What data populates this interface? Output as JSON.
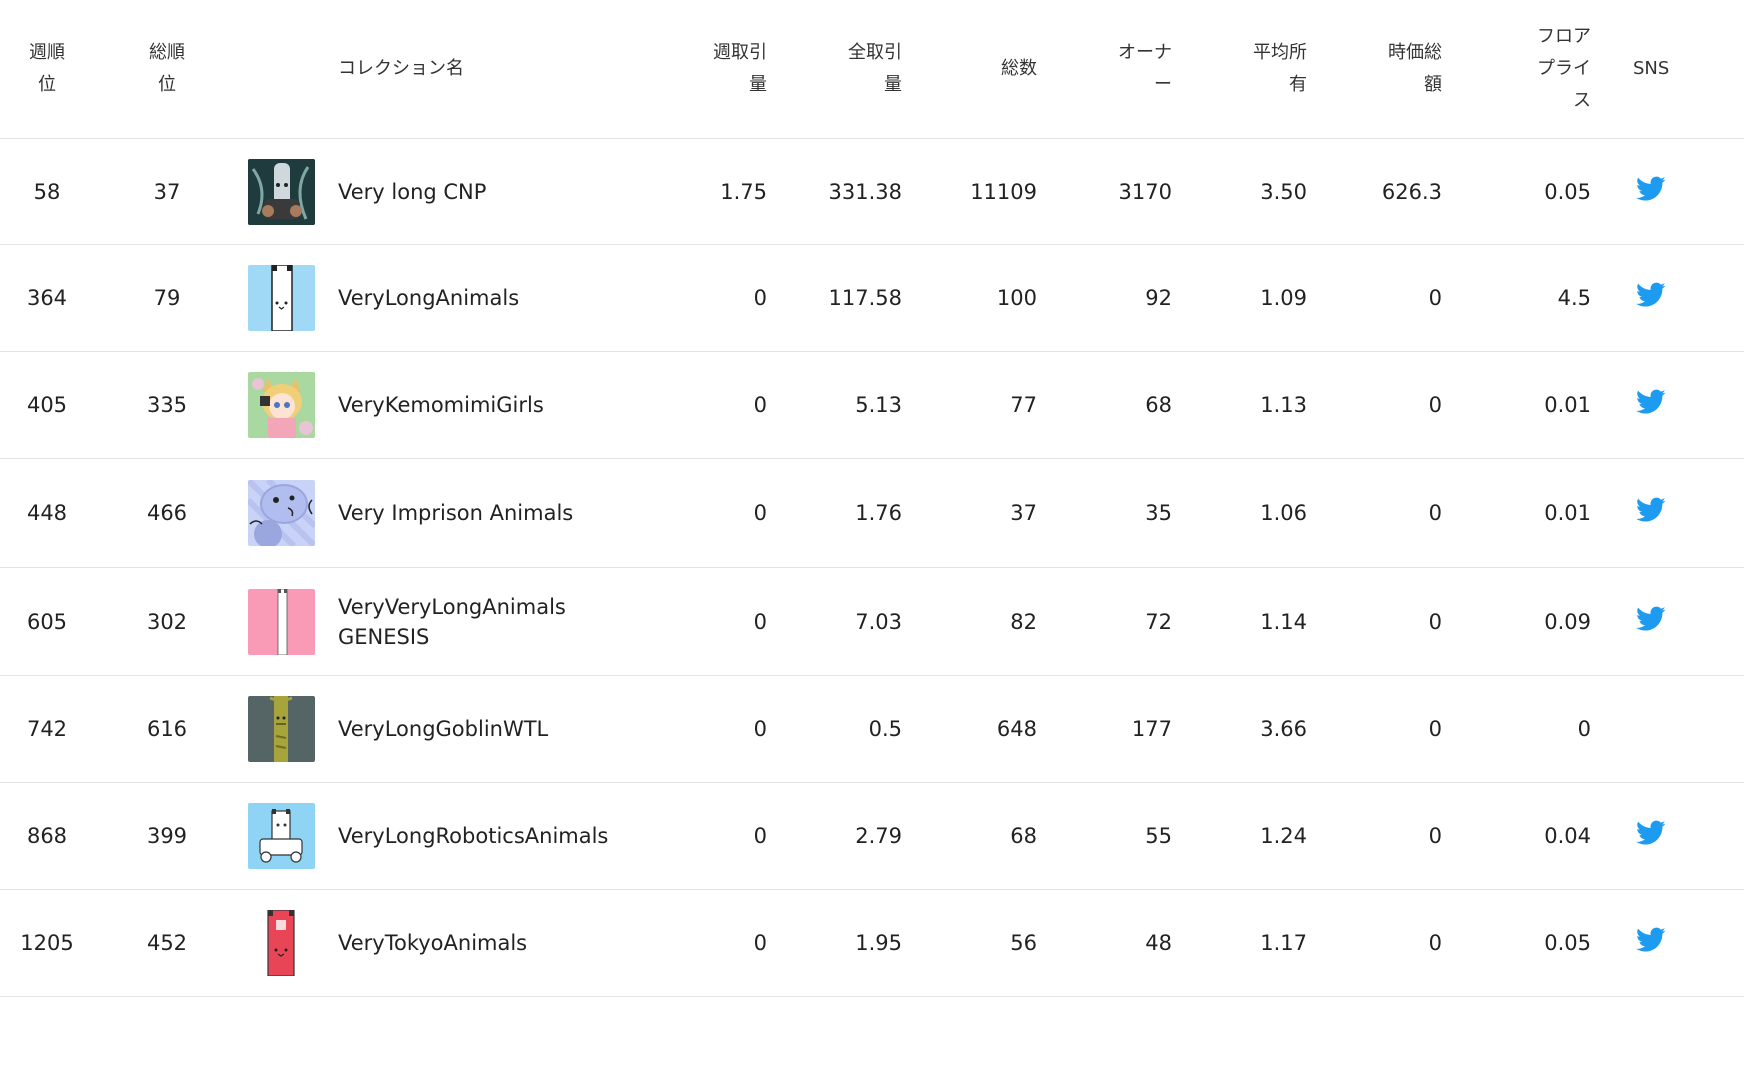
{
  "header": {
    "week_rank": "週順\n位",
    "total_rank": "総順\n位",
    "name": "コレクション名",
    "weekly_volume": "週取引\n量",
    "all_volume": "全取引\n量",
    "total_count": "総数",
    "owners": "オーナ\nー",
    "avg_holding": "平均所\n有",
    "market_cap": "時価総\n額",
    "floor_price": "フロア\nプライ\nス",
    "sns": "SNS"
  },
  "colors": {
    "twitter": "#1d9bf0",
    "divider": "#e3e3e3",
    "text": "#222222"
  },
  "rows": [
    {
      "week_rank": "58",
      "total_rank": "37",
      "thumb_icon": "cnp-character-thumbnail",
      "name": "Very long CNP",
      "weekly_volume": "1.75",
      "all_volume": "331.38",
      "total": "11109",
      "owners": "3170",
      "avg": "3.50",
      "mcap": "626.3",
      "floor": "0.05",
      "twitter": true
    },
    {
      "week_rank": "364",
      "total_rank": "79",
      "thumb_icon": "long-white-animal-thumbnail",
      "name": "VeryLongAnimals",
      "weekly_volume": "0",
      "all_volume": "117.58",
      "total": "100",
      "owners": "92",
      "avg": "1.09",
      "mcap": "0",
      "floor": "4.5",
      "twitter": true
    },
    {
      "week_rank": "405",
      "total_rank": "335",
      "thumb_icon": "kemonomimi-girl-thumbnail",
      "name": "VeryKemomimiGirls",
      "weekly_volume": "0",
      "all_volume": "5.13",
      "total": "77",
      "owners": "68",
      "avg": "1.13",
      "mcap": "0",
      "floor": "0.01",
      "twitter": true
    },
    {
      "week_rank": "448",
      "total_rank": "466",
      "thumb_icon": "imprison-seal-thumbnail",
      "name": "Very Imprison Animals",
      "weekly_volume": "0",
      "all_volume": "1.76",
      "total": "37",
      "owners": "35",
      "avg": "1.06",
      "mcap": "0",
      "floor": "0.01",
      "twitter": true
    },
    {
      "week_rank": "605",
      "total_rank": "302",
      "thumb_icon": "pink-long-animal-thumbnail",
      "name": "VeryVeryLongAnimals\nGENESIS",
      "weekly_volume": "0",
      "all_volume": "7.03",
      "total": "82",
      "owners": "72",
      "avg": "1.14",
      "mcap": "0",
      "floor": "0.09",
      "twitter": true
    },
    {
      "week_rank": "742",
      "total_rank": "616",
      "thumb_icon": "goblin-thumbnail",
      "name": "VeryLongGoblinWTL",
      "weekly_volume": "0",
      "all_volume": "0.5",
      "total": "648",
      "owners": "177",
      "avg": "3.66",
      "mcap": "0",
      "floor": "0",
      "twitter": false
    },
    {
      "week_rank": "868",
      "total_rank": "399",
      "thumb_icon": "robotics-animal-thumbnail",
      "name": "VeryLongRoboticsAnimals",
      "weekly_volume": "0",
      "all_volume": "2.79",
      "total": "68",
      "owners": "55",
      "avg": "1.24",
      "mcap": "0",
      "floor": "0.04",
      "twitter": true
    },
    {
      "week_rank": "1205",
      "total_rank": "452",
      "thumb_icon": "tokyo-animal-thumbnail",
      "name": "VeryTokyoAnimals",
      "weekly_volume": "0",
      "all_volume": "1.95",
      "total": "56",
      "owners": "48",
      "avg": "1.17",
      "mcap": "0",
      "floor": "0.05",
      "twitter": true
    }
  ]
}
